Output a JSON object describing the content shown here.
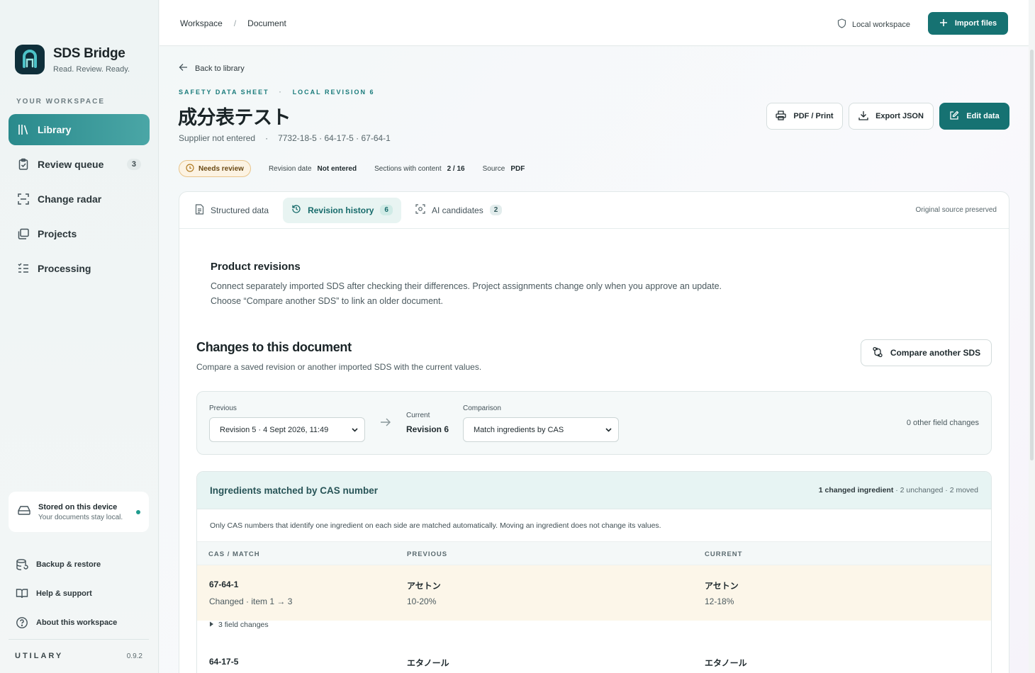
{
  "sidebar": {
    "brand_name": "SDS Bridge",
    "brand_tag": "Read. Review. Ready.",
    "section_label": "YOUR WORKSPACE",
    "nav": [
      {
        "label": "Library",
        "icon": "library-icon",
        "active": true
      },
      {
        "label": "Review queue",
        "icon": "clipboard-icon",
        "badge": "3"
      },
      {
        "label": "Change radar",
        "icon": "radar-icon"
      },
      {
        "label": "Projects",
        "icon": "folders-icon"
      },
      {
        "label": "Processing",
        "icon": "list-icon"
      }
    ],
    "device_card": {
      "title": "Stored on this device",
      "subtitle": "Your documents stay local."
    },
    "links": [
      {
        "label": "Backup & restore",
        "icon": "database-icon"
      },
      {
        "label": "Help & support",
        "icon": "book-icon"
      },
      {
        "label": "About this workspace",
        "icon": "question-icon"
      }
    ],
    "footer_brand": "UTILARY",
    "version": "0.9.2"
  },
  "topbar": {
    "breadcrumb": [
      "Workspace",
      "Document"
    ],
    "breadcrumb_sep": "/",
    "local_label": "Local workspace",
    "import_label": "Import files"
  },
  "document": {
    "back_label": "Back to library",
    "eyebrow_type": "SAFETY DATA SHEET",
    "eyebrow_sep": "·",
    "eyebrow_revision": "LOCAL REVISION 6",
    "title": "成分表テスト",
    "supplier": "Supplier not entered",
    "meta_sep": "·",
    "cas_list": "7732-18-5 · 64-17-5 · 67-64-1",
    "actions": {
      "print": "PDF / Print",
      "export": "Export JSON",
      "edit": "Edit data"
    },
    "status": {
      "badge": "Needs review",
      "revision_date_label": "Revision date",
      "revision_date_value": "Not entered",
      "sections_label": "Sections with content",
      "sections_value": "2 / 16",
      "source_label": "Source",
      "source_value": "PDF"
    }
  },
  "tabs": {
    "items": [
      {
        "label": "Structured data",
        "icon": "document-icon",
        "count": ""
      },
      {
        "label": "Revision history",
        "icon": "history-icon",
        "count": "6"
      },
      {
        "label": "AI candidates",
        "icon": "scan-icon",
        "count": "2"
      }
    ],
    "right_note": "Original source preserved"
  },
  "revisions": {
    "title": "Product revisions",
    "desc_line1": "Connect separately imported SDS after checking their differences. Project assignments change only when you approve an update.",
    "desc_line2": "Choose “Compare another SDS” to link an older document."
  },
  "changes": {
    "title": "Changes to this document",
    "subtitle": "Compare a saved revision or another imported SDS with the current values.",
    "compare_button": "Compare another SDS",
    "previous_label": "Previous",
    "previous_value": "Revision 5 · 4 Sept 2026, 11:49",
    "current_label": "Current",
    "current_value": "Revision 6",
    "comparison_label": "Comparison",
    "comparison_value": "Match ingredients by CAS",
    "other_changes": "0 other field changes"
  },
  "ingredients": {
    "title": "Ingredients matched by CAS number",
    "summary_bold": "1 changed ingredient",
    "summary_rest": " · 2 unchanged · 2 moved",
    "note": "Only CAS numbers that identify one ingredient on each side are matched automatically. Moving an ingredient does not change its values.",
    "columns": [
      "CAS / MATCH",
      "PREVIOUS",
      "CURRENT"
    ],
    "rows": [
      {
        "cas": "67-64-1",
        "match": "Changed · item 1 → 3",
        "prev_name": "アセトン",
        "prev_val": "10-20%",
        "cur_name": "アセトン",
        "cur_val": "12-18%",
        "field_changes": "3 field changes"
      },
      {
        "cas": "64-17-5",
        "prev_name": "エタノール",
        "cur_name": "エタノール"
      }
    ]
  },
  "colors": {
    "accent": "#167272",
    "accent_light": "#e8f4f2",
    "warning_bg": "#fcf3e3"
  }
}
